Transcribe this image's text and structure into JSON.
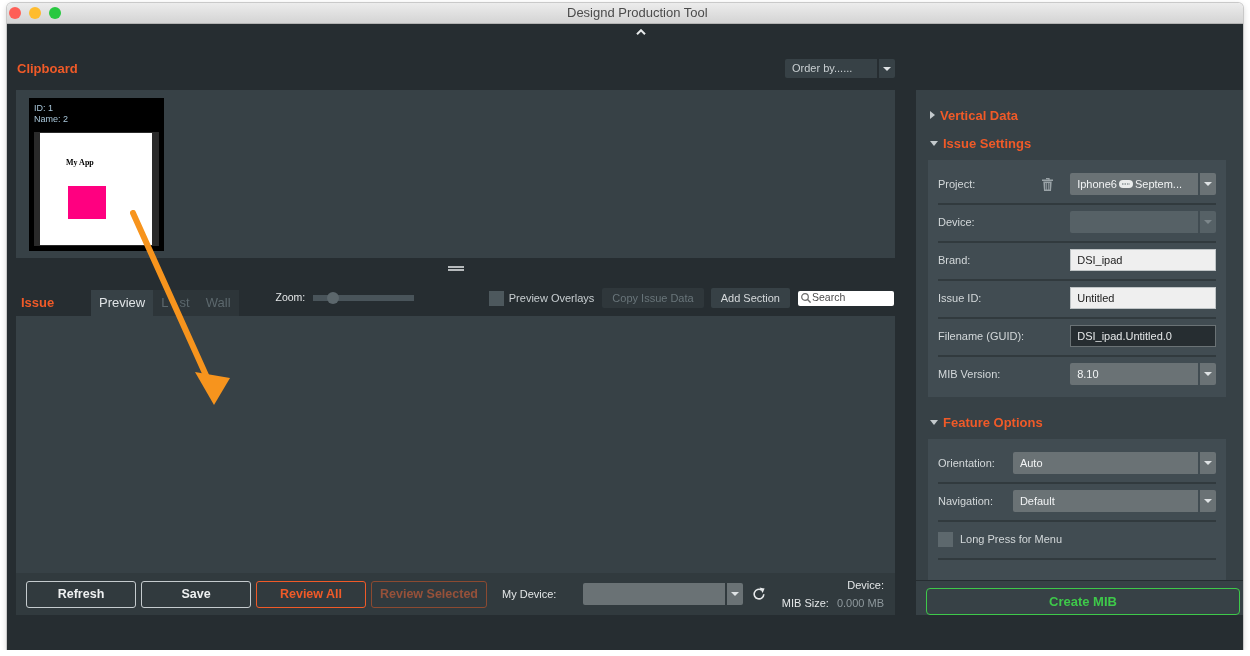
{
  "window": {
    "title": "Designd Production Tool"
  },
  "clipboard": {
    "title": "Clipboard",
    "order_by": {
      "value": "Order by......"
    },
    "cards": [
      {
        "id_line": "ID: 1",
        "name_line": "Name: 2",
        "preview_title": "My App"
      }
    ]
  },
  "issue": {
    "title": "Issue",
    "tabs": [
      {
        "label": "Preview",
        "selected": true
      },
      {
        "label": "L st",
        "selected": false
      },
      {
        "label": "Wall",
        "selected": false
      }
    ],
    "zoom": {
      "label": "Zoom:",
      "level": 0.15
    },
    "preview_overlays": {
      "label": "Preview Overlays",
      "checked": false
    },
    "buttons": [
      {
        "label": "Copy Issue Data",
        "disabled": true
      },
      {
        "label": "Add Section",
        "disabled": false
      }
    ],
    "search": {
      "placeholder": "Search"
    }
  },
  "footer": {
    "buttons": [
      {
        "label": "Refresh",
        "kind": "plain",
        "disabled": false
      },
      {
        "label": "Save",
        "kind": "plain",
        "disabled": false
      },
      {
        "label": "Review All",
        "kind": "accent",
        "disabled": false
      },
      {
        "label": "Review Selected",
        "kind": "accent",
        "disabled": true
      }
    ],
    "my_device": {
      "label": "My Device:"
    },
    "device_label": "Device:",
    "mib_size": {
      "label": "MIB Size:",
      "value": "0.000 MB"
    }
  },
  "sidebar": {
    "sections": [
      {
        "title": "Vertical Data",
        "expanded": false
      },
      {
        "title": "Issue Settings",
        "expanded": true,
        "rows": [
          {
            "kind": "select",
            "label": "Project:",
            "value_parts": [
              "Iphone6",
              "Septem..."
            ],
            "delete_icon": true,
            "disabled": false
          },
          {
            "kind": "select",
            "label": "Device:",
            "disabled": true
          },
          {
            "kind": "text",
            "label": "Brand:",
            "value": "DSI_ipad",
            "disabled": false
          },
          {
            "kind": "text",
            "label": "Issue ID:",
            "value": "Untitled",
            "disabled": false
          },
          {
            "kind": "readonly",
            "label": "Filename (GUID):",
            "value": "DSI_ipad.Untitled.0",
            "disabled": false
          },
          {
            "kind": "select",
            "label": "MIB Version:",
            "value": "8.10",
            "disabled": false
          }
        ]
      },
      {
        "title": "Feature Options",
        "expanded": true,
        "rows": [
          {
            "kind": "select",
            "label": "Orientation:",
            "value": "Auto",
            "disabled": false
          },
          {
            "kind": "select",
            "label": "Navigation:",
            "value": "Default",
            "disabled": false
          },
          {
            "kind": "checkbox",
            "label": "Long Press for Menu",
            "checked": false
          }
        ]
      }
    ],
    "create_button": "Create MIB"
  },
  "annotations": [
    {
      "kind": "arrow"
    }
  ]
}
